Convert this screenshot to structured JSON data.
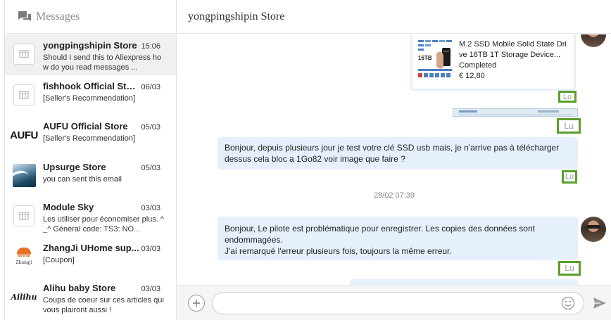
{
  "sidebar": {
    "title": "Messages",
    "conversations": [
      {
        "name": "yongpingshipin Store",
        "time": "15:06",
        "preview": "Should I send this to Aliexpress how do you read messages ...",
        "logo": "store-default-icon",
        "active": true
      },
      {
        "name": "fishhook Official Store",
        "time": "06/03",
        "preview": "[Seller's Recommendation]",
        "logo": "store-default-icon"
      },
      {
        "name": "AUFU Official Store",
        "time": "05/03",
        "preview": "[Seller's Recommendation]",
        "logo": "aufu-logo",
        "logo_text": "AUFU"
      },
      {
        "name": "Upsurge Store",
        "time": "05/03",
        "preview": "you can sent this email",
        "logo": "wave-logo"
      },
      {
        "name": "Module Sky",
        "time": "03/03",
        "preview": "Les utiliser pour économiser plus. ^_^ Général code: TS3: NO...",
        "logo": "store-default-icon"
      },
      {
        "name": "ZhangJi UHome sup...",
        "time": "03/03",
        "preview": "[Coupon]",
        "logo": "zhangji-logo",
        "logo_text": "Zhangji"
      },
      {
        "name": "Alihu baby Store",
        "time": "03/03",
        "preview": "Coups de coeur sur ces articles qui vous plairont aussi !",
        "logo": "ailihu-logo",
        "logo_text": "Ailihu"
      }
    ]
  },
  "chat": {
    "store_title": "yongpingshipin Store",
    "product": {
      "name": "M.2 SSD Mobile Solid State Drive 16TB 1T Storage Device...",
      "status": "Completed",
      "price": "€ 12,80",
      "image_label": "16TB"
    },
    "read_label": "Lu",
    "messages": [
      {
        "text": "Bonjour, depuis plusieurs jour je test votre clé SSD usb mais, je n'arrive pas à télécharger dessus cela bloc a 1Go82 voir image que faire ?"
      },
      {
        "text_line1": "Bonjour, Le pilote est problématique pour enregistrer. Les copies des données sont endommagées.",
        "text_line2": "J'ai remarqué l'erreur plusieurs fois, toujours la même erreur."
      }
    ],
    "date_separator": "28/02 07:39"
  },
  "composer": {
    "placeholder": "",
    "value": ""
  },
  "colors": {
    "bubble": "#e6f0fc",
    "highlight": "#5a9e2b",
    "active_row": "#f0f0f0"
  }
}
